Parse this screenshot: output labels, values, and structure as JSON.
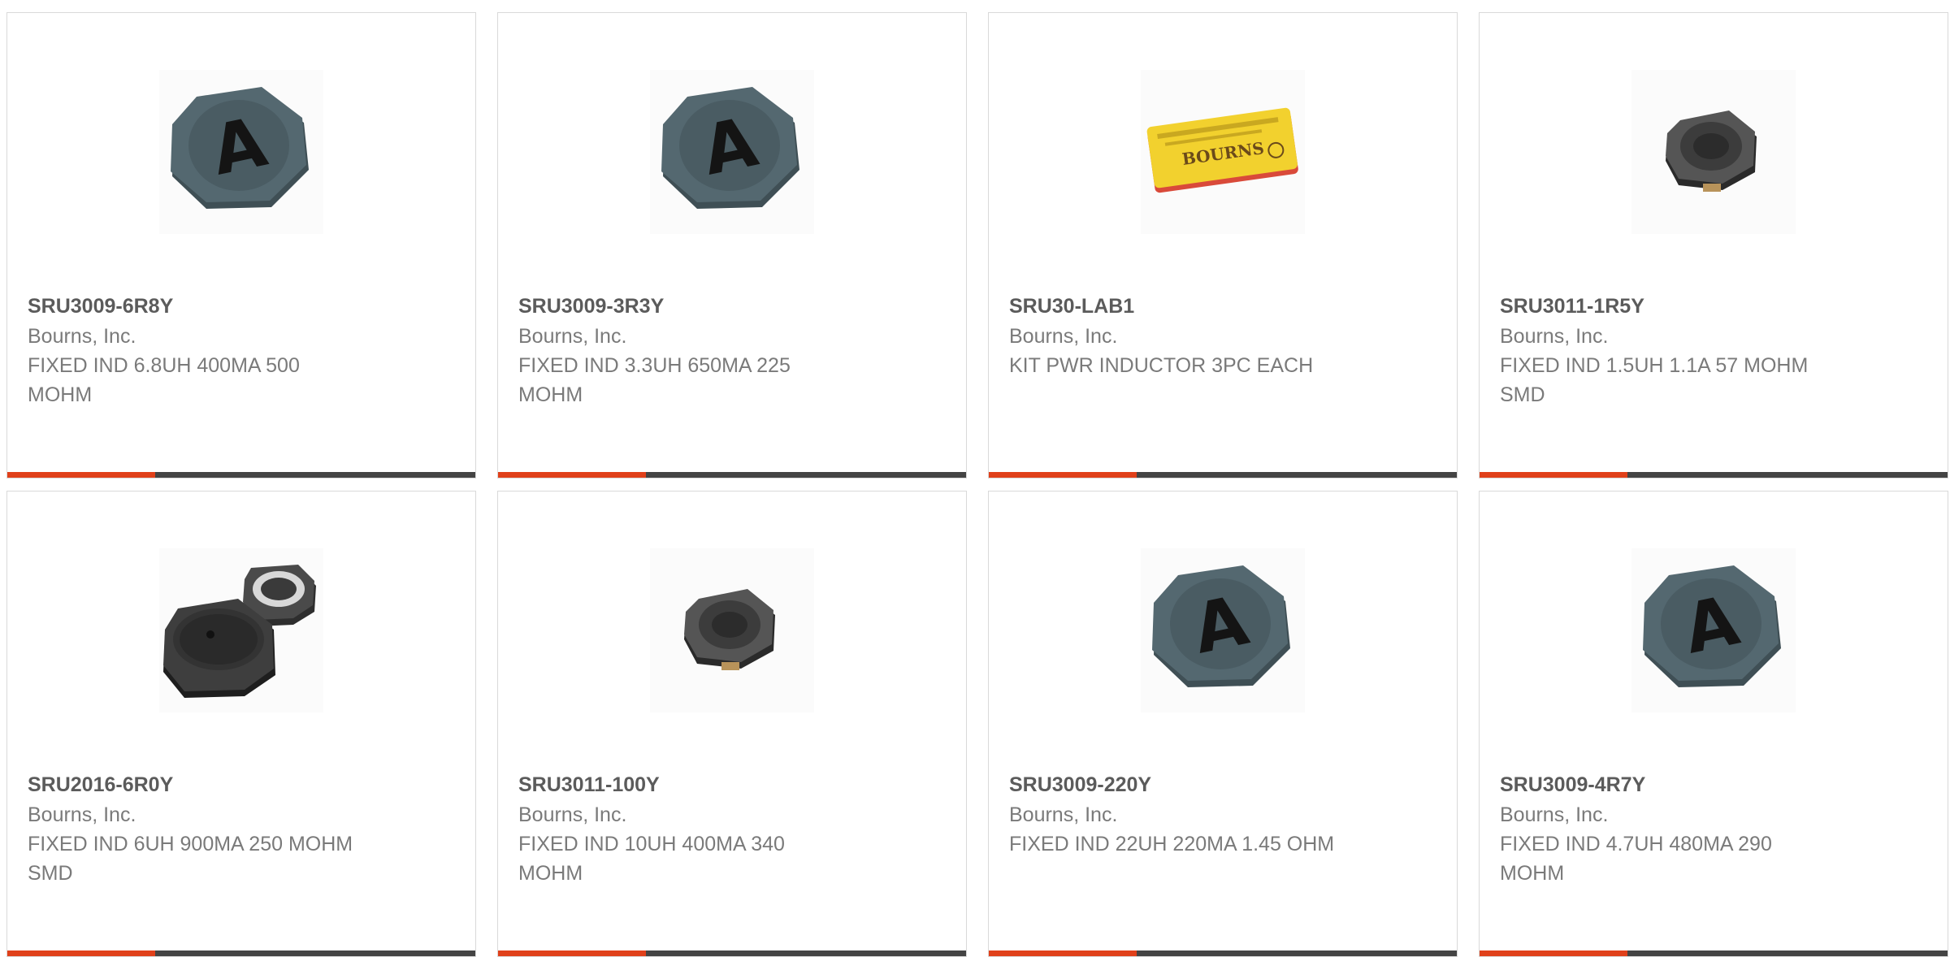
{
  "products": [
    {
      "part_number": "SRU3009-6R8Y",
      "manufacturer": "Bourns, Inc.",
      "description": "FIXED IND 6.8UH 400MA 500 MOHM",
      "image": "a-marked-inductor-icon"
    },
    {
      "part_number": "SRU3009-3R3Y",
      "manufacturer": "Bourns, Inc.",
      "description": "FIXED IND 3.3UH 650MA 225 MOHM",
      "image": "a-marked-inductor-icon"
    },
    {
      "part_number": "SRU30-LAB1",
      "manufacturer": "Bourns, Inc.",
      "description": "KIT PWR INDUCTOR 3PC EACH",
      "image": "kit-box-icon",
      "image_text": "BOURNS"
    },
    {
      "part_number": "SRU3011-1R5Y",
      "manufacturer": "Bourns, Inc.",
      "description": "FIXED IND 1.5UH 1.1A 57 MOHM SMD",
      "image": "small-smd-inductor-icon"
    },
    {
      "part_number": "SRU2016-6R0Y",
      "manufacturer": "Bourns, Inc.",
      "description": "FIXED IND 6UH 900MA 250 MOHM SMD",
      "image": "dual-inductor-icon"
    },
    {
      "part_number": "SRU3011-100Y",
      "manufacturer": "Bourns, Inc.",
      "description": "FIXED IND 10UH 400MA 340 MOHM",
      "image": "small-smd-inductor-icon"
    },
    {
      "part_number": "SRU3009-220Y",
      "manufacturer": "Bourns, Inc.",
      "description": "FIXED IND 22UH 220MA 1.45 OHM",
      "image": "a-marked-inductor-icon"
    },
    {
      "part_number": "SRU3009-4R7Y",
      "manufacturer": "Bourns, Inc.",
      "description": "FIXED IND 4.7UH 480MA 290 MOHM",
      "image": "a-marked-inductor-icon"
    }
  ],
  "colors": {
    "accent": "#e0401a",
    "bar": "#444444",
    "part_number_text": "#5b5b5b",
    "secondary_text": "#7a7a7a",
    "card_border": "#d9d9d9",
    "inductor_body": "#4e5f66",
    "kit_box": "#f2d12e"
  }
}
